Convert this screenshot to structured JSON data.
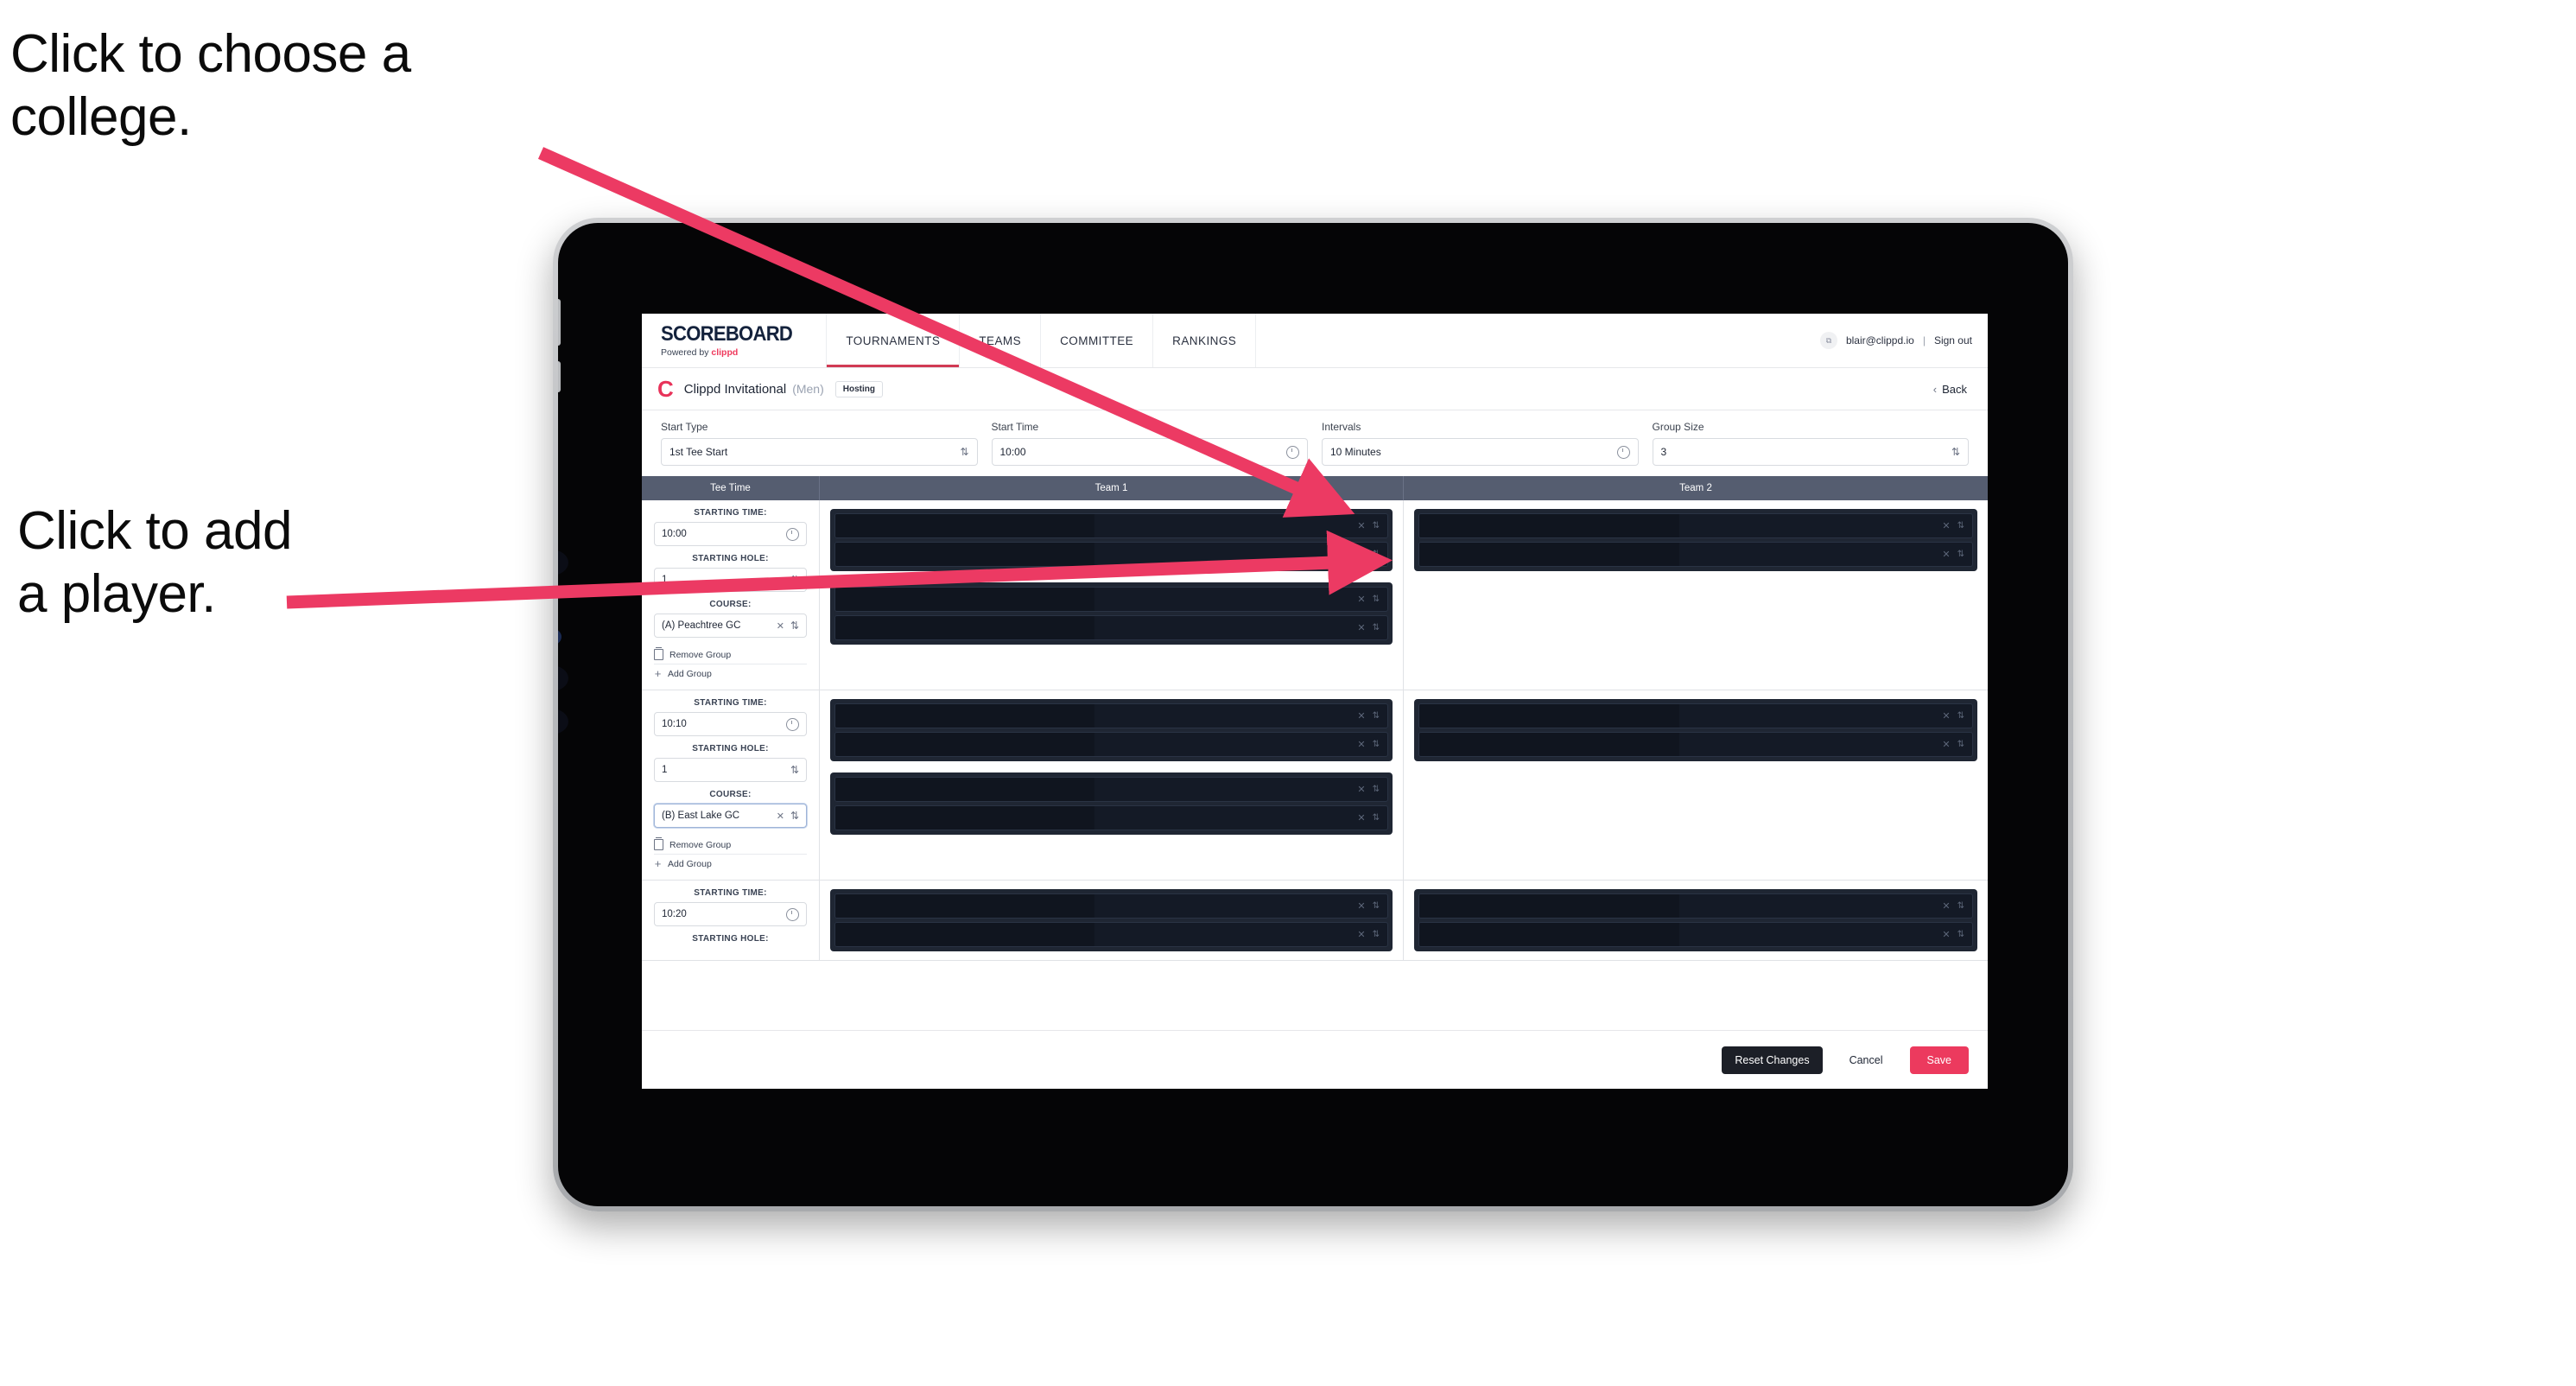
{
  "annotations": {
    "college": "Click to choose a\ncollege.",
    "player": "Click to add\na player."
  },
  "colors": {
    "accent_pink": "#ec3a5e",
    "arrow_pink": "#ec3a63",
    "nav_underline": "#d13a54",
    "table_header": "#555d70",
    "player_row_bg": "#141a26",
    "group_card_bg": "#1f2633",
    "dark_button": "#1c1f27"
  },
  "navbar": {
    "brand_title": "SCOREBOARD",
    "brand_sub_prefix": "Powered by ",
    "brand_sub_name": "clippd",
    "items": [
      {
        "label": "TOURNAMENTS",
        "active": true
      },
      {
        "label": "TEAMS",
        "active": false
      },
      {
        "label": "COMMITTEE",
        "active": false
      },
      {
        "label": "RANKINGS",
        "active": false
      }
    ],
    "avatar_glyph": "⧉",
    "email": "blair@clippd.io",
    "separator": "|",
    "sign_out": "Sign out"
  },
  "titlebar": {
    "logo_letter": "C",
    "tournament_name": "Clippd Invitational",
    "gender": "(Men)",
    "badge": "Hosting",
    "back_label": "Back",
    "back_chevron": "‹"
  },
  "filters": [
    {
      "label": "Start Type",
      "value": "1st Tee Start",
      "control": "select"
    },
    {
      "label": "Start Time",
      "value": "10:00",
      "control": "time"
    },
    {
      "label": "Intervals",
      "value": "10 Minutes",
      "control": "time"
    },
    {
      "label": "Group Size",
      "value": "3",
      "control": "select"
    }
  ],
  "table": {
    "headers": [
      "Tee Time",
      "Team 1",
      "Team 2"
    ],
    "labels": {
      "starting_time": "STARTING TIME:",
      "starting_hole": "STARTING HOLE:",
      "course": "COURSE:",
      "remove_group": "Remove Group",
      "add_group": "Add Group",
      "clear_glyph": "✕",
      "spinner_glyph": "⇅"
    },
    "rows": [
      {
        "starting_time": "10:00",
        "starting_hole": "1",
        "course": "(A) Peachtree GC",
        "course_focused": false,
        "team1_groups": [
          2,
          2
        ],
        "team2_groups": [
          2
        ]
      },
      {
        "starting_time": "10:10",
        "starting_hole": "1",
        "course": "(B) East Lake GC",
        "course_focused": true,
        "team1_groups": [
          2,
          2
        ],
        "team2_groups": [
          2
        ]
      },
      {
        "starting_time": "10:20",
        "starting_hole": "",
        "course": "",
        "course_focused": false,
        "team1_groups": [
          2
        ],
        "team2_groups": [
          2
        ],
        "partial": true
      }
    ]
  },
  "footer": {
    "reset_label": "Reset Changes",
    "cancel_label": "Cancel",
    "save_label": "Save"
  }
}
